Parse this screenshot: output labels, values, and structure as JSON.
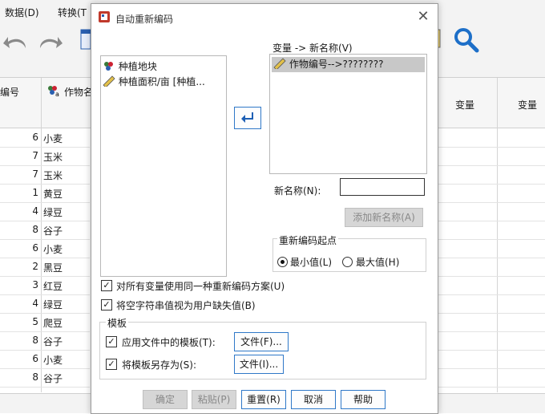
{
  "menubar": {
    "items": [
      "数据(D)",
      "转换(T"
    ]
  },
  "grid": {
    "col_headers": [
      "编号",
      "作物名",
      "变量",
      "变量"
    ],
    "rows": [
      {
        "num": "6",
        "crop": "小麦"
      },
      {
        "num": "7",
        "crop": "玉米"
      },
      {
        "num": "7",
        "crop": "玉米"
      },
      {
        "num": "1",
        "crop": "黄豆"
      },
      {
        "num": "4",
        "crop": "绿豆"
      },
      {
        "num": "8",
        "crop": "谷子"
      },
      {
        "num": "6",
        "crop": "小麦"
      },
      {
        "num": "2",
        "crop": "黑豆"
      },
      {
        "num": "3",
        "crop": "红豆"
      },
      {
        "num": "4",
        "crop": "绿豆"
      },
      {
        "num": "5",
        "crop": "爬豆"
      },
      {
        "num": "8",
        "crop": "谷子"
      },
      {
        "num": "6",
        "crop": "小麦"
      },
      {
        "num": "8",
        "crop": "谷子"
      }
    ]
  },
  "dialog": {
    "title": "自动重新编码",
    "source_vars": [
      "种植地块",
      "种植面积/亩 [种植..."
    ],
    "mapping_label": "变量 -> 新名称(V)",
    "mapping_items": [
      "作物编号-->????????"
    ],
    "new_name_label": "新名称(N):",
    "new_name_value": "",
    "add_new_name_button": "添加新名称(A)",
    "start_group_label": "重新编码起点",
    "radio_min": "最小值(L)",
    "radio_max": "最大值(H)",
    "radio_selected": "min",
    "check_same_scheme": "对所有变量使用同一种重新编码方案(U)",
    "check_blank_missing": "将空字符串值视为用户缺失值(B)",
    "template_group_label": "模板",
    "check_apply_template": "应用文件中的模板(T):",
    "check_save_template": "将模板另存为(S):",
    "file_button_1": "文件(F)...",
    "file_button_2": "文件(I)...",
    "ok_button": "确定",
    "paste_button": "粘贴(P)",
    "reset_button": "重置(R)",
    "cancel_button": "取消",
    "help_button": "帮助"
  }
}
